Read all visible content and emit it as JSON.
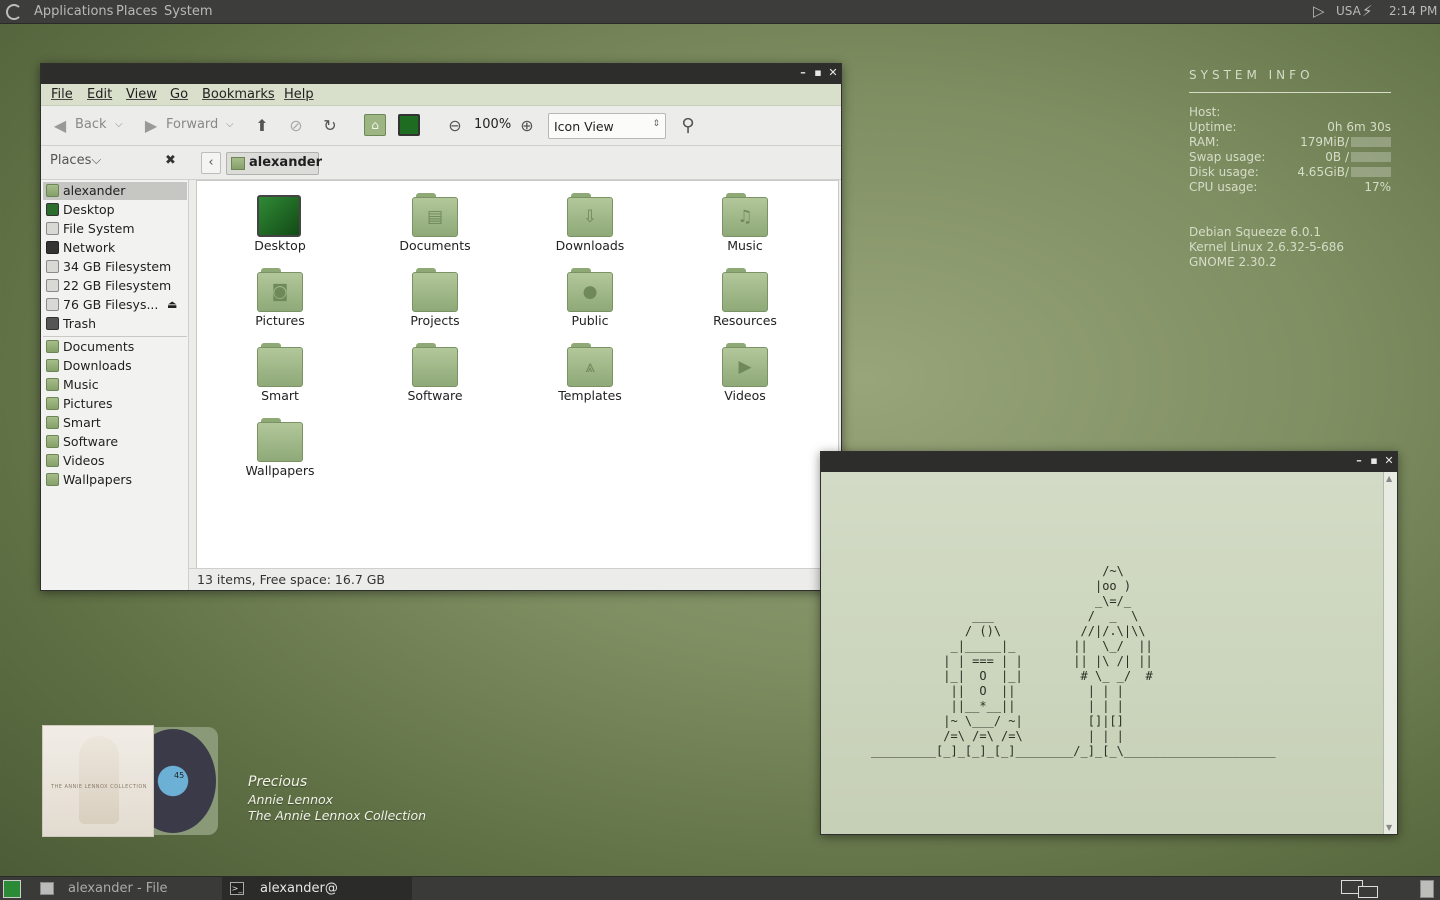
{
  "top_panel": {
    "menus": [
      "Applications",
      "Places",
      "System"
    ],
    "keyboard_layout": "USA",
    "clock": "2:14 PM"
  },
  "file_browser": {
    "menu": [
      "File",
      "Edit",
      "View",
      "Go",
      "Bookmarks",
      "Help"
    ],
    "toolbar": {
      "back": "Back",
      "forward": "Forward",
      "zoom": "100%",
      "view_mode": "Icon View"
    },
    "places_label": "Places",
    "location": "alexander",
    "sidebar": {
      "devices": [
        "alexander",
        "Desktop",
        "File System",
        "Network",
        "34 GB Filesystem",
        "22 GB Filesystem",
        "76 GB Filesys...",
        "Trash"
      ],
      "bookmarks": [
        "Documents",
        "Downloads",
        "Music",
        "Pictures",
        "Smart",
        "Software",
        "Videos",
        "Wallpapers"
      ]
    },
    "items": [
      "Desktop",
      "Documents",
      "Downloads",
      "Music",
      "Pictures",
      "Projects",
      "Public",
      "Resources",
      "Smart",
      "Software",
      "Templates",
      "Videos",
      "Wallpapers"
    ],
    "status": "13 items, Free space: 16.7 GB"
  },
  "system_info": {
    "heading": "SYSTEM INFO",
    "host_label": "Host:",
    "uptime_label": "Uptime:",
    "uptime": "0h 6m 30s",
    "ram_label": "RAM:",
    "ram": "179MiB/",
    "swap_label": "Swap usage:",
    "swap": "0B /",
    "disk_label": "Disk usage:",
    "disk": "4.65GiB/",
    "cpu_label": "CPU usage:",
    "cpu": "17%",
    "distro": "Debian Squeeze 6.0.1",
    "kernel": "Kernel Linux 2.6.32-5-686",
    "desktop": "GNOME 2.30.2"
  },
  "terminal": {
    "ascii_art": "                                /~\\\n                               |oo )\n                               _\\=/_\n              ___             /  _  \\\n             / ()\\           //|/.\\|\\\\\n           _|_____|_        ||  \\_/  ||\n          | | === | |       || |\\ /| ||\n          |_|  O  |_|        # \\_ _/  #\n           ||  O  ||          | | |\n           ||__*__||          | | |\n          |~ \\___/ ~|         []|[]\n          /=\\ /=\\ /=\\         | | |\n_________[_]_[_]_[_]________/_]_[_\\_____________________"
  },
  "now_playing": {
    "title": "Precious",
    "artist": "Annie Lennox",
    "album": "The Annie Lennox Collection",
    "cover_text": "THE ANNIE LENNOX COLLECTION",
    "disc_text": "45"
  },
  "bottom_panel": {
    "tasks": [
      "alexander - File Browser",
      "alexander@"
    ]
  }
}
